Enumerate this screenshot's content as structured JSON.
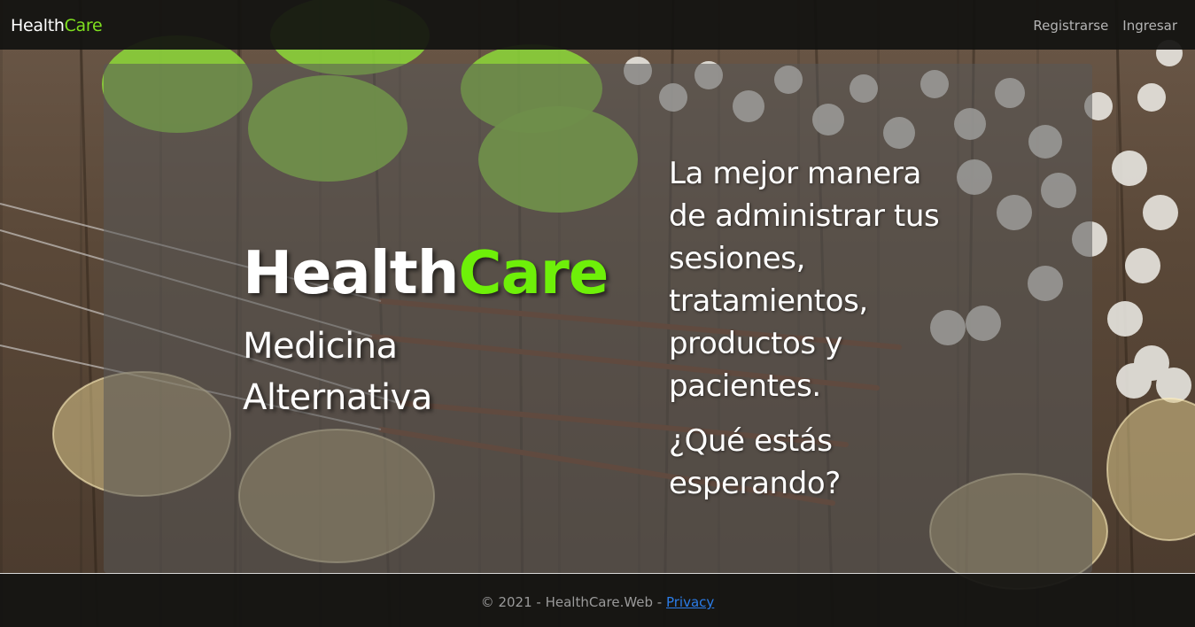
{
  "navbar": {
    "brand_part1": "Health",
    "brand_part2": "Care",
    "links": [
      "Registrarse",
      "Ingresar"
    ]
  },
  "hero": {
    "title_part1": "Health",
    "title_part2": "Care",
    "subtitle": "Medicina Alternativa",
    "pitch": "La mejor manera de administrar tus sesiones, tratamientos, productos y pacientes.",
    "question": "¿Qué estás esperando?"
  },
  "footer": {
    "text": "© 2021 - HealthCare.Web - ",
    "privacy_link": "Privacy"
  },
  "colors": {
    "brand_green": "#7fe01f",
    "navbar_bg": "#121210",
    "link_blue": "#2b7de9"
  }
}
